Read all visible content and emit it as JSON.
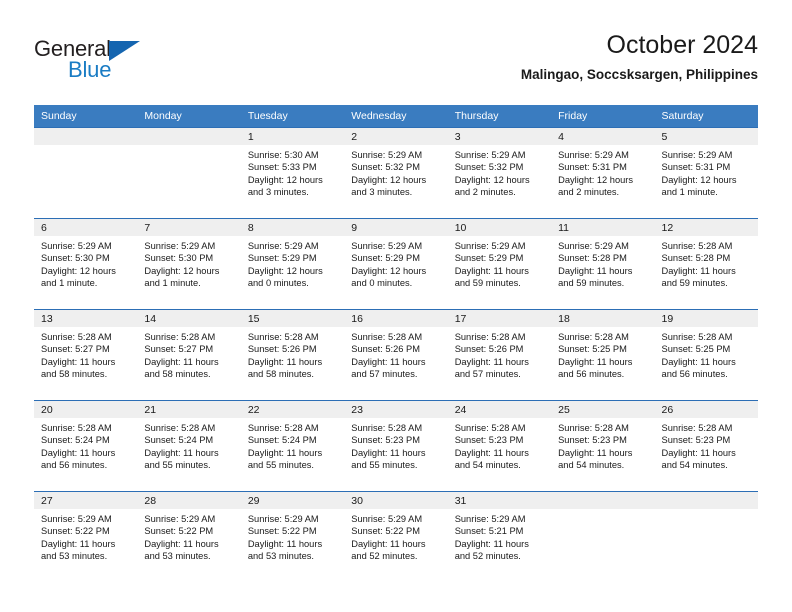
{
  "brand": {
    "name_part1": "General",
    "name_part2": "Blue"
  },
  "header": {
    "title": "October 2024",
    "subtitle": "Malingao, Soccsksargen, Philippines"
  },
  "weekday_headers": [
    "Sunday",
    "Monday",
    "Tuesday",
    "Wednesday",
    "Thursday",
    "Friday",
    "Saturday"
  ],
  "colors": {
    "header_blue": "#3a7cc0",
    "grid_line": "#2c6eb5",
    "daynum_bg": "#efefef",
    "brand_blue": "#1a7cc4",
    "text": "#1a1a1a"
  },
  "weeks": [
    [
      {
        "day": "",
        "sunrise": "",
        "sunset": "",
        "daylight_line1": "",
        "daylight_line2": "",
        "empty": true
      },
      {
        "day": "",
        "sunrise": "",
        "sunset": "",
        "daylight_line1": "",
        "daylight_line2": "",
        "empty": true
      },
      {
        "day": "1",
        "sunrise": "Sunrise: 5:30 AM",
        "sunset": "Sunset: 5:33 PM",
        "daylight_line1": "Daylight: 12 hours",
        "daylight_line2": "and 3 minutes."
      },
      {
        "day": "2",
        "sunrise": "Sunrise: 5:29 AM",
        "sunset": "Sunset: 5:32 PM",
        "daylight_line1": "Daylight: 12 hours",
        "daylight_line2": "and 3 minutes."
      },
      {
        "day": "3",
        "sunrise": "Sunrise: 5:29 AM",
        "sunset": "Sunset: 5:32 PM",
        "daylight_line1": "Daylight: 12 hours",
        "daylight_line2": "and 2 minutes."
      },
      {
        "day": "4",
        "sunrise": "Sunrise: 5:29 AM",
        "sunset": "Sunset: 5:31 PM",
        "daylight_line1": "Daylight: 12 hours",
        "daylight_line2": "and 2 minutes."
      },
      {
        "day": "5",
        "sunrise": "Sunrise: 5:29 AM",
        "sunset": "Sunset: 5:31 PM",
        "daylight_line1": "Daylight: 12 hours",
        "daylight_line2": "and 1 minute."
      }
    ],
    [
      {
        "day": "6",
        "sunrise": "Sunrise: 5:29 AM",
        "sunset": "Sunset: 5:30 PM",
        "daylight_line1": "Daylight: 12 hours",
        "daylight_line2": "and 1 minute."
      },
      {
        "day": "7",
        "sunrise": "Sunrise: 5:29 AM",
        "sunset": "Sunset: 5:30 PM",
        "daylight_line1": "Daylight: 12 hours",
        "daylight_line2": "and 1 minute."
      },
      {
        "day": "8",
        "sunrise": "Sunrise: 5:29 AM",
        "sunset": "Sunset: 5:29 PM",
        "daylight_line1": "Daylight: 12 hours",
        "daylight_line2": "and 0 minutes."
      },
      {
        "day": "9",
        "sunrise": "Sunrise: 5:29 AM",
        "sunset": "Sunset: 5:29 PM",
        "daylight_line1": "Daylight: 12 hours",
        "daylight_line2": "and 0 minutes."
      },
      {
        "day": "10",
        "sunrise": "Sunrise: 5:29 AM",
        "sunset": "Sunset: 5:29 PM",
        "daylight_line1": "Daylight: 11 hours",
        "daylight_line2": "and 59 minutes."
      },
      {
        "day": "11",
        "sunrise": "Sunrise: 5:29 AM",
        "sunset": "Sunset: 5:28 PM",
        "daylight_line1": "Daylight: 11 hours",
        "daylight_line2": "and 59 minutes."
      },
      {
        "day": "12",
        "sunrise": "Sunrise: 5:28 AM",
        "sunset": "Sunset: 5:28 PM",
        "daylight_line1": "Daylight: 11 hours",
        "daylight_line2": "and 59 minutes."
      }
    ],
    [
      {
        "day": "13",
        "sunrise": "Sunrise: 5:28 AM",
        "sunset": "Sunset: 5:27 PM",
        "daylight_line1": "Daylight: 11 hours",
        "daylight_line2": "and 58 minutes."
      },
      {
        "day": "14",
        "sunrise": "Sunrise: 5:28 AM",
        "sunset": "Sunset: 5:27 PM",
        "daylight_line1": "Daylight: 11 hours",
        "daylight_line2": "and 58 minutes."
      },
      {
        "day": "15",
        "sunrise": "Sunrise: 5:28 AM",
        "sunset": "Sunset: 5:26 PM",
        "daylight_line1": "Daylight: 11 hours",
        "daylight_line2": "and 58 minutes."
      },
      {
        "day": "16",
        "sunrise": "Sunrise: 5:28 AM",
        "sunset": "Sunset: 5:26 PM",
        "daylight_line1": "Daylight: 11 hours",
        "daylight_line2": "and 57 minutes."
      },
      {
        "day": "17",
        "sunrise": "Sunrise: 5:28 AM",
        "sunset": "Sunset: 5:26 PM",
        "daylight_line1": "Daylight: 11 hours",
        "daylight_line2": "and 57 minutes."
      },
      {
        "day": "18",
        "sunrise": "Sunrise: 5:28 AM",
        "sunset": "Sunset: 5:25 PM",
        "daylight_line1": "Daylight: 11 hours",
        "daylight_line2": "and 56 minutes."
      },
      {
        "day": "19",
        "sunrise": "Sunrise: 5:28 AM",
        "sunset": "Sunset: 5:25 PM",
        "daylight_line1": "Daylight: 11 hours",
        "daylight_line2": "and 56 minutes."
      }
    ],
    [
      {
        "day": "20",
        "sunrise": "Sunrise: 5:28 AM",
        "sunset": "Sunset: 5:24 PM",
        "daylight_line1": "Daylight: 11 hours",
        "daylight_line2": "and 56 minutes."
      },
      {
        "day": "21",
        "sunrise": "Sunrise: 5:28 AM",
        "sunset": "Sunset: 5:24 PM",
        "daylight_line1": "Daylight: 11 hours",
        "daylight_line2": "and 55 minutes."
      },
      {
        "day": "22",
        "sunrise": "Sunrise: 5:28 AM",
        "sunset": "Sunset: 5:24 PM",
        "daylight_line1": "Daylight: 11 hours",
        "daylight_line2": "and 55 minutes."
      },
      {
        "day": "23",
        "sunrise": "Sunrise: 5:28 AM",
        "sunset": "Sunset: 5:23 PM",
        "daylight_line1": "Daylight: 11 hours",
        "daylight_line2": "and 55 minutes."
      },
      {
        "day": "24",
        "sunrise": "Sunrise: 5:28 AM",
        "sunset": "Sunset: 5:23 PM",
        "daylight_line1": "Daylight: 11 hours",
        "daylight_line2": "and 54 minutes."
      },
      {
        "day": "25",
        "sunrise": "Sunrise: 5:28 AM",
        "sunset": "Sunset: 5:23 PM",
        "daylight_line1": "Daylight: 11 hours",
        "daylight_line2": "and 54 minutes."
      },
      {
        "day": "26",
        "sunrise": "Sunrise: 5:28 AM",
        "sunset": "Sunset: 5:23 PM",
        "daylight_line1": "Daylight: 11 hours",
        "daylight_line2": "and 54 minutes."
      }
    ],
    [
      {
        "day": "27",
        "sunrise": "Sunrise: 5:29 AM",
        "sunset": "Sunset: 5:22 PM",
        "daylight_line1": "Daylight: 11 hours",
        "daylight_line2": "and 53 minutes."
      },
      {
        "day": "28",
        "sunrise": "Sunrise: 5:29 AM",
        "sunset": "Sunset: 5:22 PM",
        "daylight_line1": "Daylight: 11 hours",
        "daylight_line2": "and 53 minutes."
      },
      {
        "day": "29",
        "sunrise": "Sunrise: 5:29 AM",
        "sunset": "Sunset: 5:22 PM",
        "daylight_line1": "Daylight: 11 hours",
        "daylight_line2": "and 53 minutes."
      },
      {
        "day": "30",
        "sunrise": "Sunrise: 5:29 AM",
        "sunset": "Sunset: 5:22 PM",
        "daylight_line1": "Daylight: 11 hours",
        "daylight_line2": "and 52 minutes."
      },
      {
        "day": "31",
        "sunrise": "Sunrise: 5:29 AM",
        "sunset": "Sunset: 5:21 PM",
        "daylight_line1": "Daylight: 11 hours",
        "daylight_line2": "and 52 minutes."
      },
      {
        "day": "",
        "sunrise": "",
        "sunset": "",
        "daylight_line1": "",
        "daylight_line2": "",
        "empty": true
      },
      {
        "day": "",
        "sunrise": "",
        "sunset": "",
        "daylight_line1": "",
        "daylight_line2": "",
        "empty": true
      }
    ]
  ]
}
